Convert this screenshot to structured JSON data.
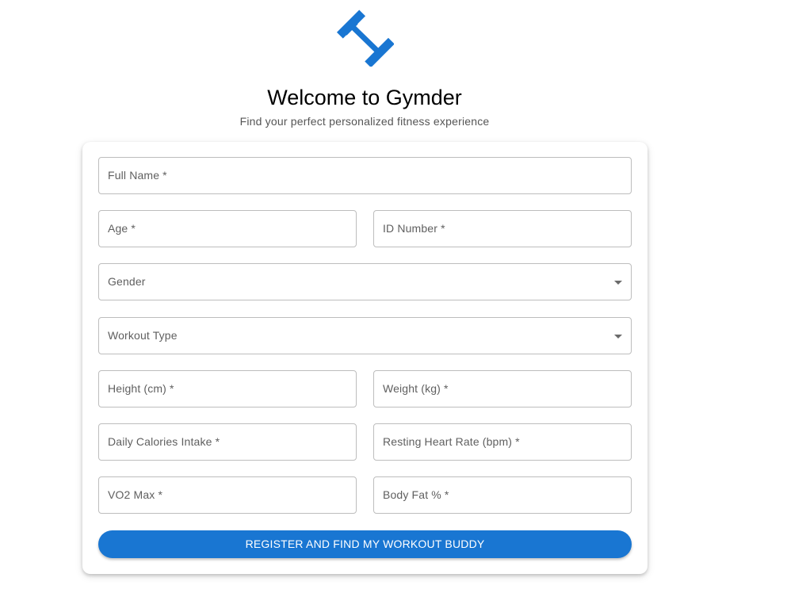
{
  "brand": {
    "logo_icon": "dumbbell-icon",
    "accent_color": "#1976d2"
  },
  "header": {
    "title": "Welcome to Gymder",
    "subtitle": "Find your perfect personalized fitness experience"
  },
  "form": {
    "full_name": {
      "label": "Full Name *",
      "value": ""
    },
    "age": {
      "label": "Age *",
      "value": ""
    },
    "id_number": {
      "label": "ID Number *",
      "value": ""
    },
    "gender": {
      "label": "Gender",
      "value": ""
    },
    "workout_type": {
      "label": "Workout Type",
      "value": ""
    },
    "height": {
      "label": "Height (cm) *",
      "value": ""
    },
    "weight": {
      "label": "Weight (kg) *",
      "value": ""
    },
    "daily_calories": {
      "label": "Daily Calories Intake *",
      "value": ""
    },
    "resting_heart_rate": {
      "label": "Resting Heart Rate (bpm) *",
      "value": ""
    },
    "vo2_max": {
      "label": "VO2 Max *",
      "value": ""
    },
    "body_fat": {
      "label": "Body Fat % *",
      "value": ""
    },
    "submit_label": "REGISTER AND FIND MY WORKOUT BUDDY"
  }
}
